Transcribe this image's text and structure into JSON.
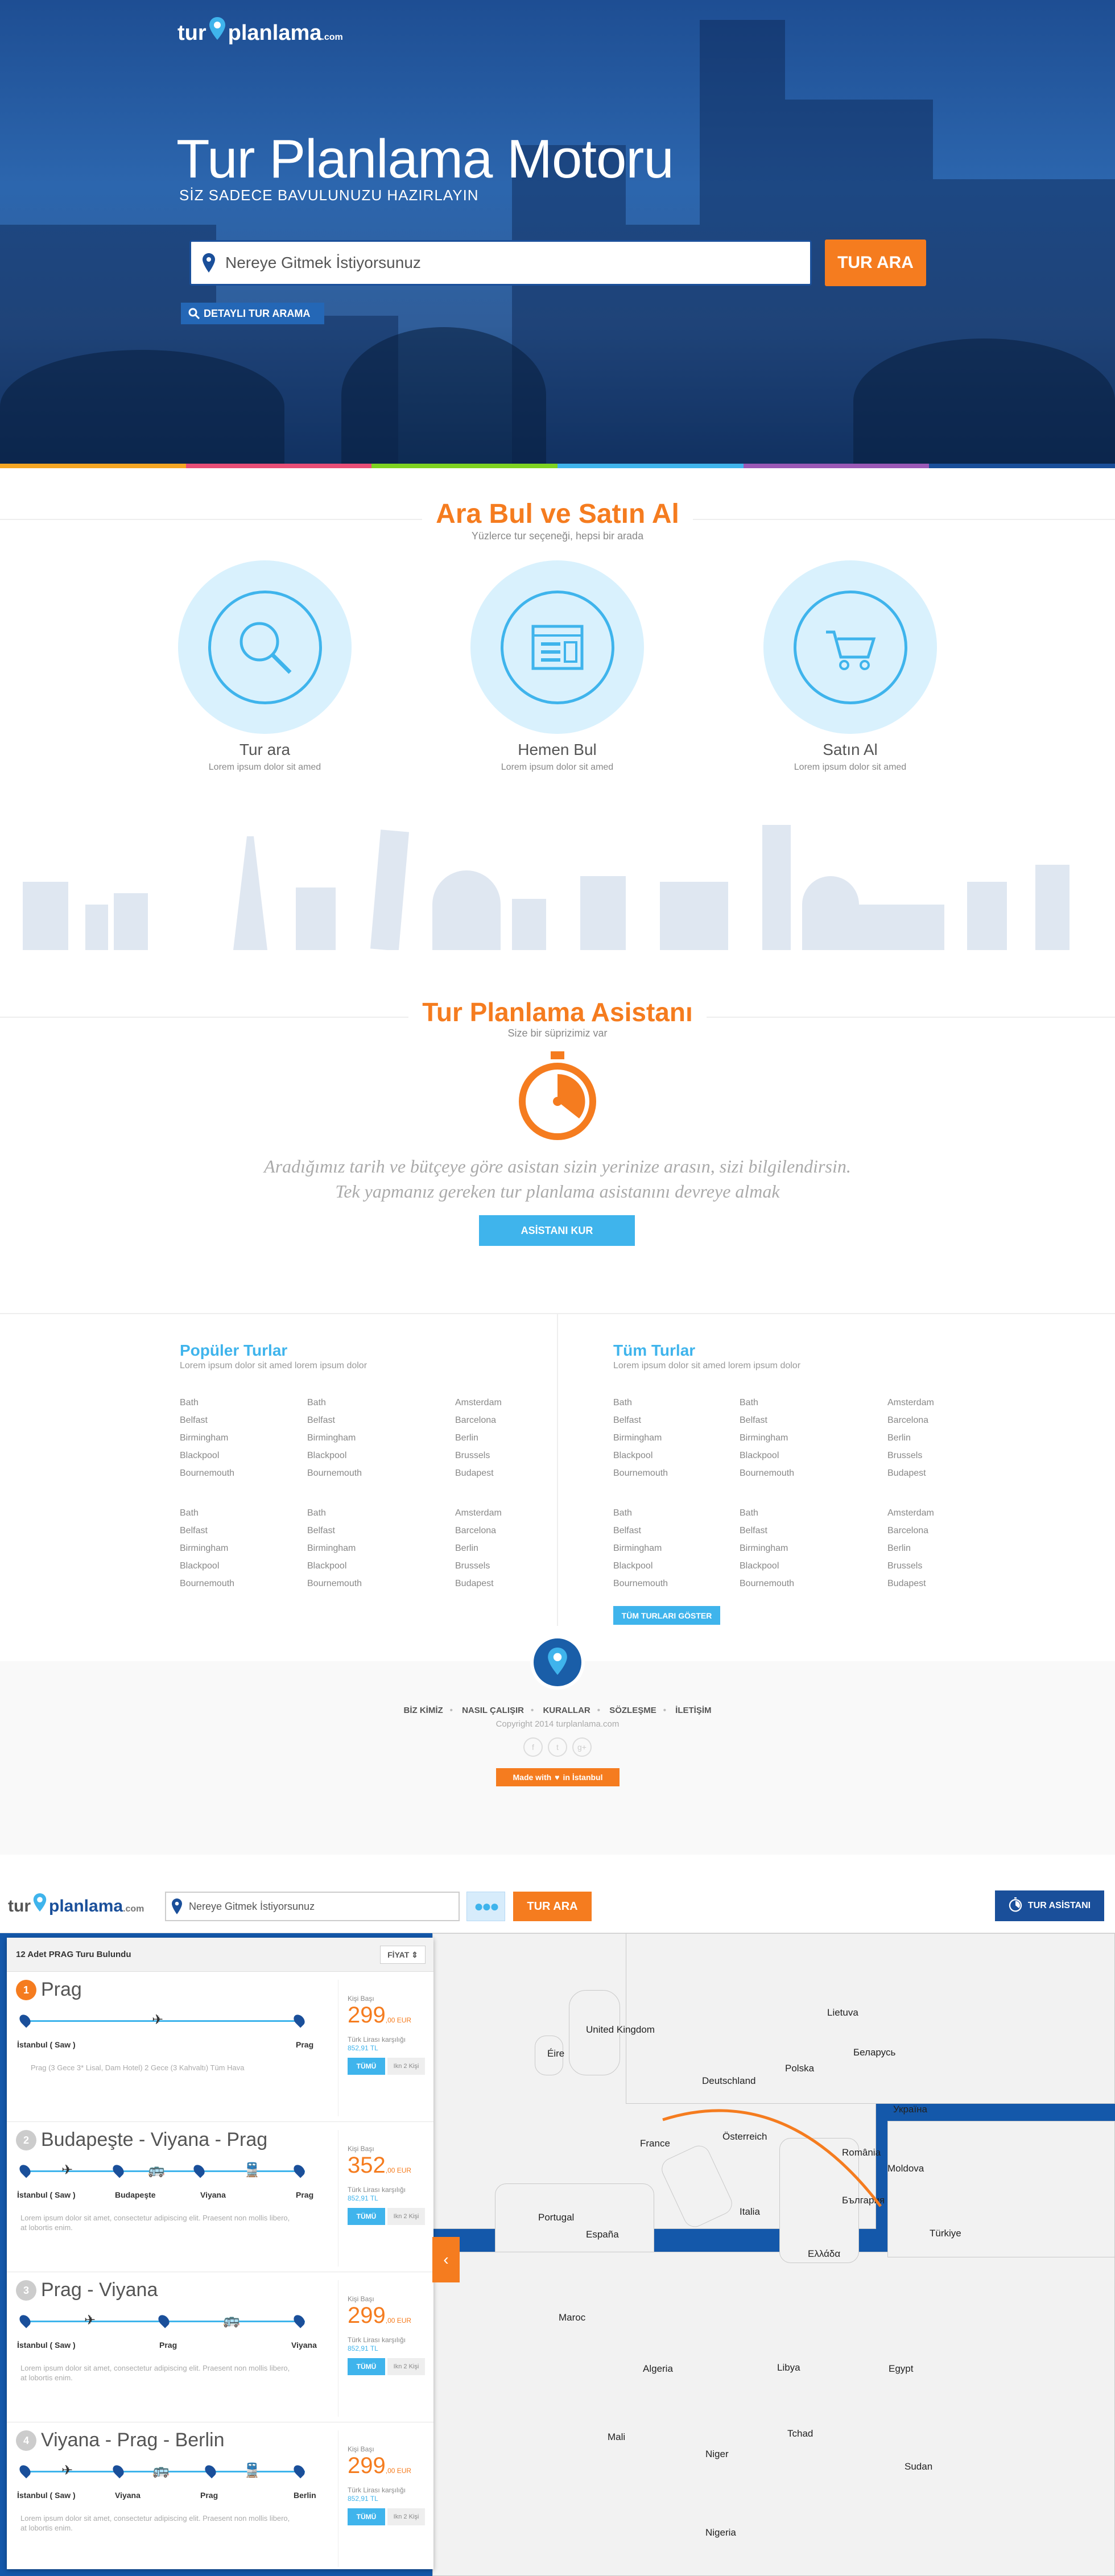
{
  "brand": {
    "left": "tur",
    "right": "planlama",
    "com": ".com"
  },
  "hero": {
    "title": "Tur Planlama Motoru",
    "subtitle": "SİZ SADECE BAVULUNUZU HAZIRLAYIN",
    "search_placeholder": "Nereye Gitmek İstiyorsunuz",
    "search_button": "TUR ARA",
    "detail_button": "DETAYLI TUR ARAMA"
  },
  "colors": {
    "accent_orange": "#f57c1f",
    "accent_blue": "#3fb4ec",
    "brand_dark": "#1a4f9a",
    "rainbow": [
      "#f5a623",
      "#e94e77",
      "#7ed321",
      "#3fb4ec",
      "#9b59b6",
      "#1a4f9a"
    ]
  },
  "features": {
    "title": "Ara Bul ve Satın Al",
    "subtitle": "Yüzlerce tur seçeneği, hepsi bir arada",
    "items": [
      {
        "icon": "magnifier-icon",
        "title": "Tur ara",
        "sub": "Lorem ipsum dolor sit amed"
      },
      {
        "icon": "browser-window-icon",
        "title": "Hemen Bul",
        "sub": "Lorem ipsum dolor sit amed"
      },
      {
        "icon": "shopping-cart-icon",
        "title": "Satın Al",
        "sub": "Lorem ipsum dolor sit amed"
      }
    ]
  },
  "assistant": {
    "title": "Tur Planlama Asistanı",
    "subtitle": "Size bir süprizimiz var",
    "icon": "stopwatch-icon",
    "line1": "Aradığımız tarih ve bütçeye göre asistan sizin yerinize arasın, sizi bilgilendirsin.",
    "line2": "Tek yapmanız gereken tur planlama asistanını devreye almak",
    "button": "ASİSTANI KUR"
  },
  "popular": {
    "title": "Popüler Turlar",
    "subtitle": "Lorem ipsum dolor sit amed lorem ipsum dolor",
    "groups": [
      {
        "col1": [
          "Bath",
          "Belfast",
          "Birmingham",
          "Blackpool",
          "Bournemouth"
        ],
        "col2": [
          "Bath",
          "Belfast",
          "Birmingham",
          "Blackpool",
          "Bournemouth"
        ],
        "col3": [
          "Amsterdam",
          "Barcelona",
          "Berlin",
          "Brussels",
          "Budapest"
        ]
      },
      {
        "col1": [
          "Bath",
          "Belfast",
          "Birmingham",
          "Blackpool",
          "Bournemouth"
        ],
        "col2": [
          "Bath",
          "Belfast",
          "Birmingham",
          "Blackpool",
          "Bournemouth"
        ],
        "col3": [
          "Amsterdam",
          "Barcelona",
          "Berlin",
          "Brussels",
          "Budapest"
        ]
      }
    ]
  },
  "all_tours": {
    "title": "Tüm Turlar",
    "subtitle": "Lorem ipsum dolor sit amed lorem ipsum dolor",
    "button": "TÜM TURLARI GÖSTER",
    "groups": [
      {
        "col1": [
          "Bath",
          "Belfast",
          "Birmingham",
          "Blackpool",
          "Bournemouth"
        ],
        "col2": [
          "Bath",
          "Belfast",
          "Birmingham",
          "Blackpool",
          "Bournemouth"
        ],
        "col3": [
          "Amsterdam",
          "Barcelona",
          "Berlin",
          "Brussels",
          "Budapest"
        ]
      },
      {
        "col1": [
          "Bath",
          "Belfast",
          "Birmingham",
          "Blackpool",
          "Bournemouth"
        ],
        "col2": [
          "Bath",
          "Belfast",
          "Birmingham",
          "Blackpool",
          "Bournemouth"
        ],
        "col3": [
          "Amsterdam",
          "Barcelona",
          "Berlin",
          "Brussels",
          "Budapest"
        ]
      }
    ]
  },
  "footer": {
    "links": [
      "BİZ KİMİZ",
      "NASIL ÇALIŞIR",
      "KURALLAR",
      "SÖZLEŞME",
      "İLETİŞİM"
    ],
    "copyright": "Copyright 2014 turplanlama.com",
    "social": [
      "f",
      "t",
      "g+"
    ],
    "made_with_pre": "Made with",
    "made_with_post": "in İstanbul"
  },
  "app": {
    "search_value": "Nereye Gitmek İstiyorsunuz",
    "search_button": "TUR ARA",
    "assistant_button": "TUR ASİSTANI",
    "results_count": "12 Adet PRAG Turu Bulundu",
    "sort_label": "FİYAT",
    "cards": [
      {
        "num": "1",
        "title": "Prag",
        "stops": [
          "İstanbul ( Saw )",
          "Prag"
        ],
        "modes": [
          "✈"
        ],
        "desc": "Prag (3 Gece 3* Lisal, Dam Hotel) 2 Gece (3 Kahvaltı) Tüm Hava",
        "per": "Kişi Başı",
        "price": "299",
        "eur": ",00 EUR",
        "tl": "Türk Lirası karşılığı",
        "tl_value": "852,91 TL",
        "tum": "TÜMÜ",
        "ikon": "Ikn 2 Kişi"
      },
      {
        "num": "2",
        "title": "Budapeşte - Viyana - Prag",
        "stops": [
          "İstanbul ( Saw )",
          "Budapeşte",
          "Viyana",
          "Prag"
        ],
        "modes": [
          "✈",
          "🚌",
          "🚆"
        ],
        "desc": "Lorem ipsum dolor sit amet, consectetur adipiscing elit. Praesent non mollis libero, at lobortis enim.",
        "per": "Kişi Başı",
        "price": "352",
        "eur": ",00 EUR",
        "tl": "Türk Lirası karşılığı",
        "tl_value": "852,91 TL",
        "tum": "TÜMÜ",
        "ikon": "Ikn 2 Kişi"
      },
      {
        "num": "3",
        "title": "Prag - Viyana",
        "stops": [
          "İstanbul ( Saw )",
          "Prag",
          "Viyana"
        ],
        "modes": [
          "✈",
          "🚌"
        ],
        "desc": "Lorem ipsum dolor sit amet, consectetur adipiscing elit. Praesent non mollis libero, at lobortis enim.",
        "per": "Kişi Başı",
        "price": "299",
        "eur": ",00 EUR",
        "tl": "Türk Lirası karşılığı",
        "tl_value": "852,91 TL",
        "tum": "TÜMÜ",
        "ikon": "Ikn 2 Kişi"
      },
      {
        "num": "4",
        "title": "Viyana - Prag - Berlin",
        "stops": [
          "İstanbul ( Saw )",
          "Viyana",
          "Prag",
          "Berlin"
        ],
        "modes": [
          "✈",
          "🚌",
          "🚆"
        ],
        "desc": "Lorem ipsum dolor sit amet, consectetur adipiscing elit. Praesent non mollis libero, at lobortis enim.",
        "per": "Kişi Başı",
        "price": "299",
        "eur": ",00 EUR",
        "tl": "Türk Lirası karşılığı",
        "tl_value": "852,91 TL",
        "tum": "TÜMÜ",
        "ikon": "Ikn 2 Kişi"
      }
    ],
    "map_labels": [
      "France",
      "Deutschland",
      "Polska",
      "Україна",
      "Türkiye",
      "España",
      "Portugal",
      "Italia",
      "România",
      "Беларусь",
      "Mali",
      "Niger",
      "Nigeria",
      "Tchad",
      "Sudan",
      "Egypt",
      "Libya",
      "Algeria",
      "Maroc",
      "Éire",
      "United Kingdom",
      "Lietuva",
      "Moldova",
      "Österreich",
      "България",
      "Ελλάδα"
    ]
  }
}
